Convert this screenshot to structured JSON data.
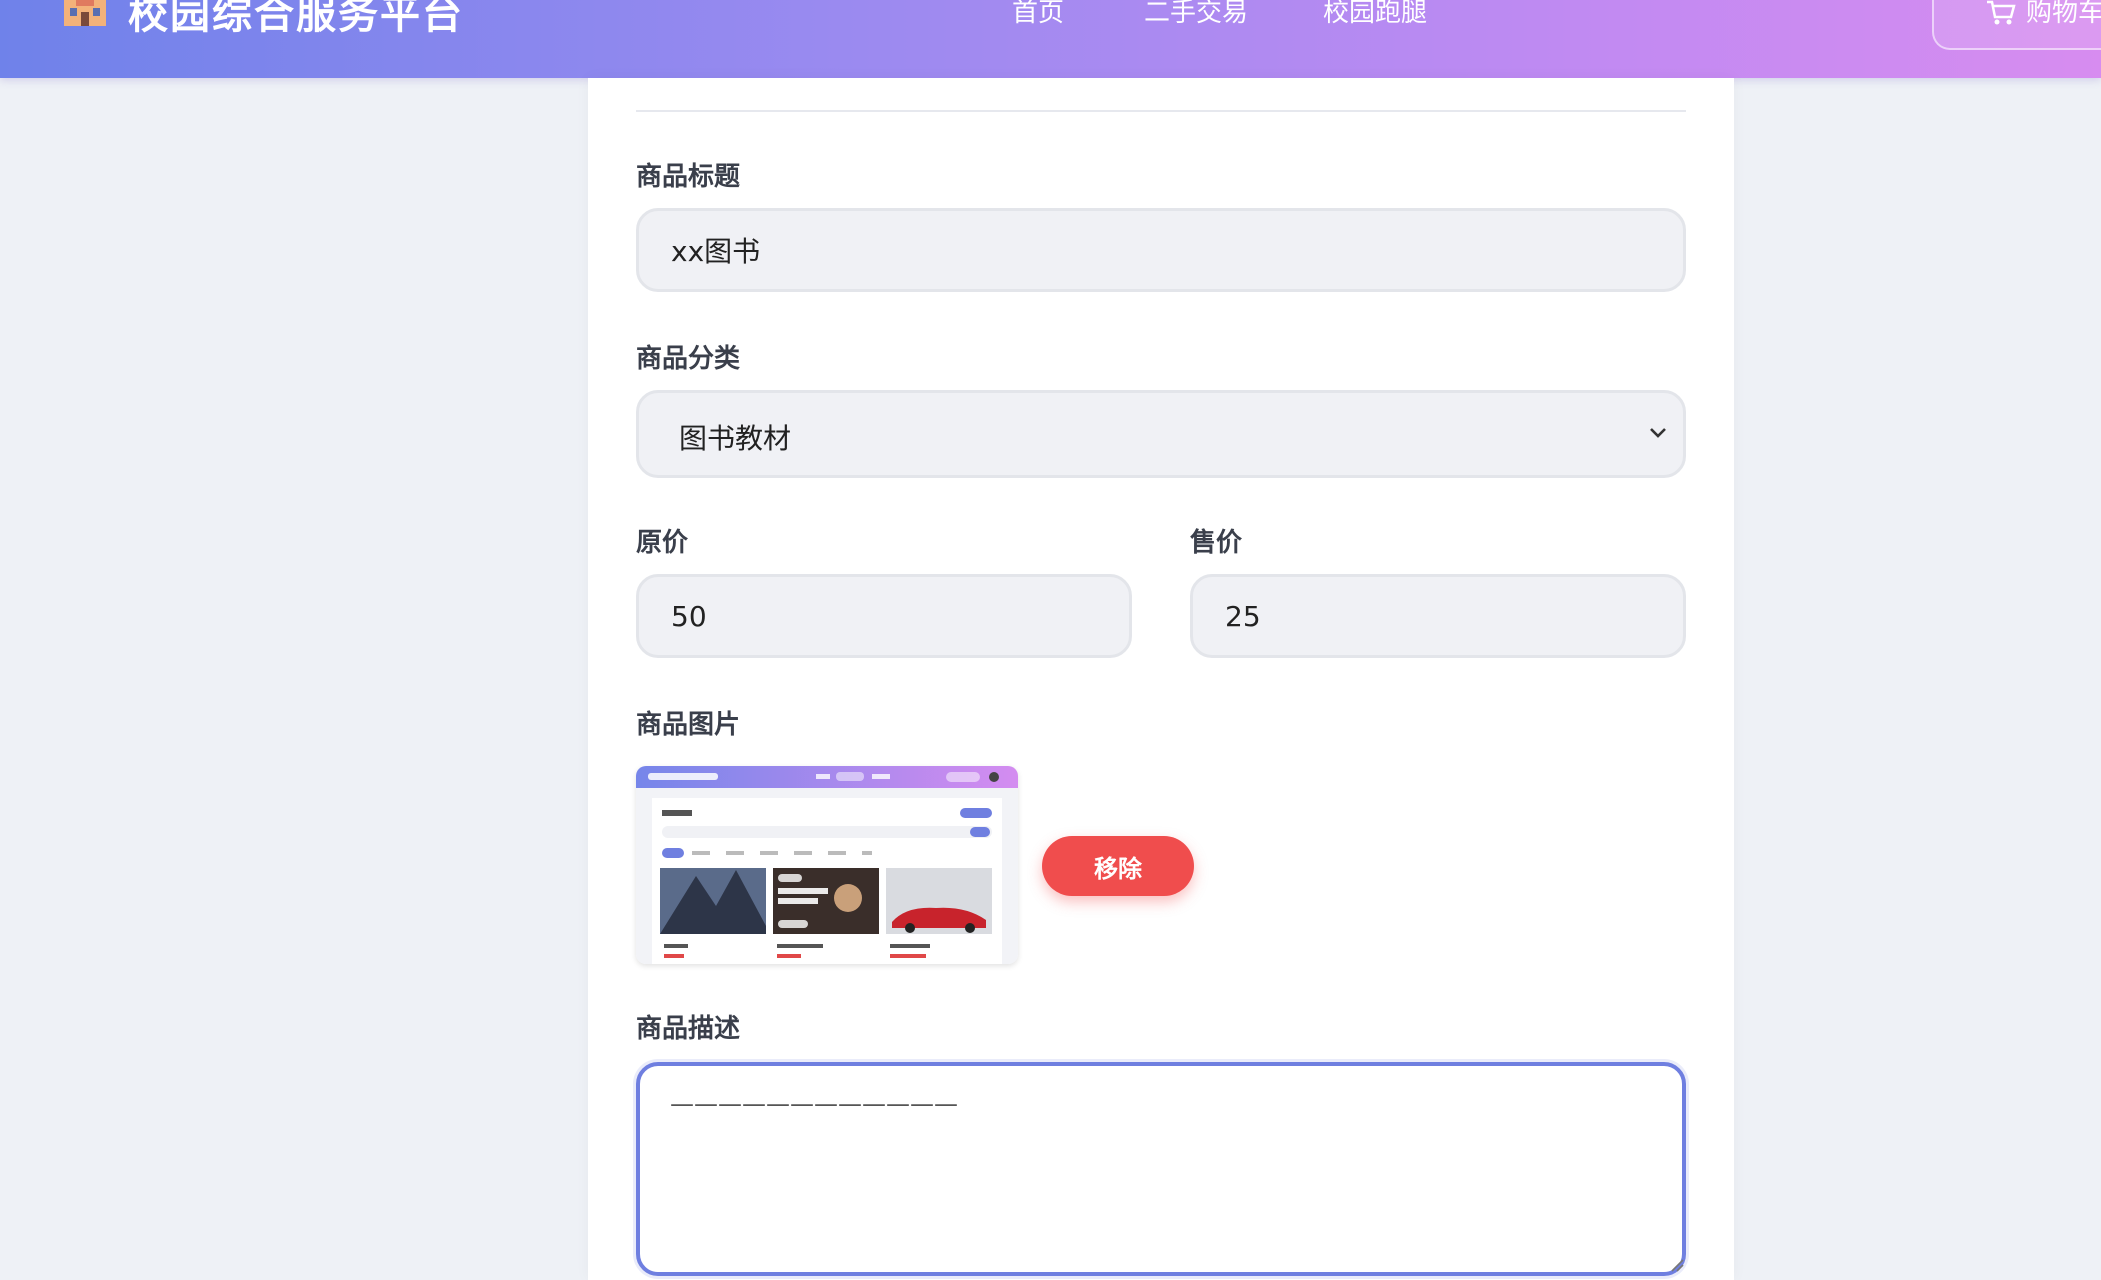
{
  "header": {
    "app_title": "校园综合服务平台",
    "nav": [
      "首页",
      "二手交易",
      "校园跑腿"
    ],
    "cart_label": "购物车",
    "logo_icon": "school-building-icon",
    "cart_icon": "shopping-cart-icon",
    "gradient_colors": [
      "#6f82ea",
      "#c08af2",
      "#d78cf0"
    ]
  },
  "form": {
    "title_label": "商品标题",
    "title_value": "xx图书",
    "category_label": "商品分类",
    "category_value": "图书教材",
    "original_price_label": "原价",
    "original_price_value": "50",
    "sale_price_label": "售价",
    "sale_price_value": "25",
    "image_label": "商品图片",
    "remove_label": "移除",
    "description_label": "商品描述",
    "description_value": "————————————"
  },
  "colors": {
    "remove_button": "#f04d4d",
    "focus_border": "#6f7fe0",
    "page_background": "#eef1f6"
  }
}
